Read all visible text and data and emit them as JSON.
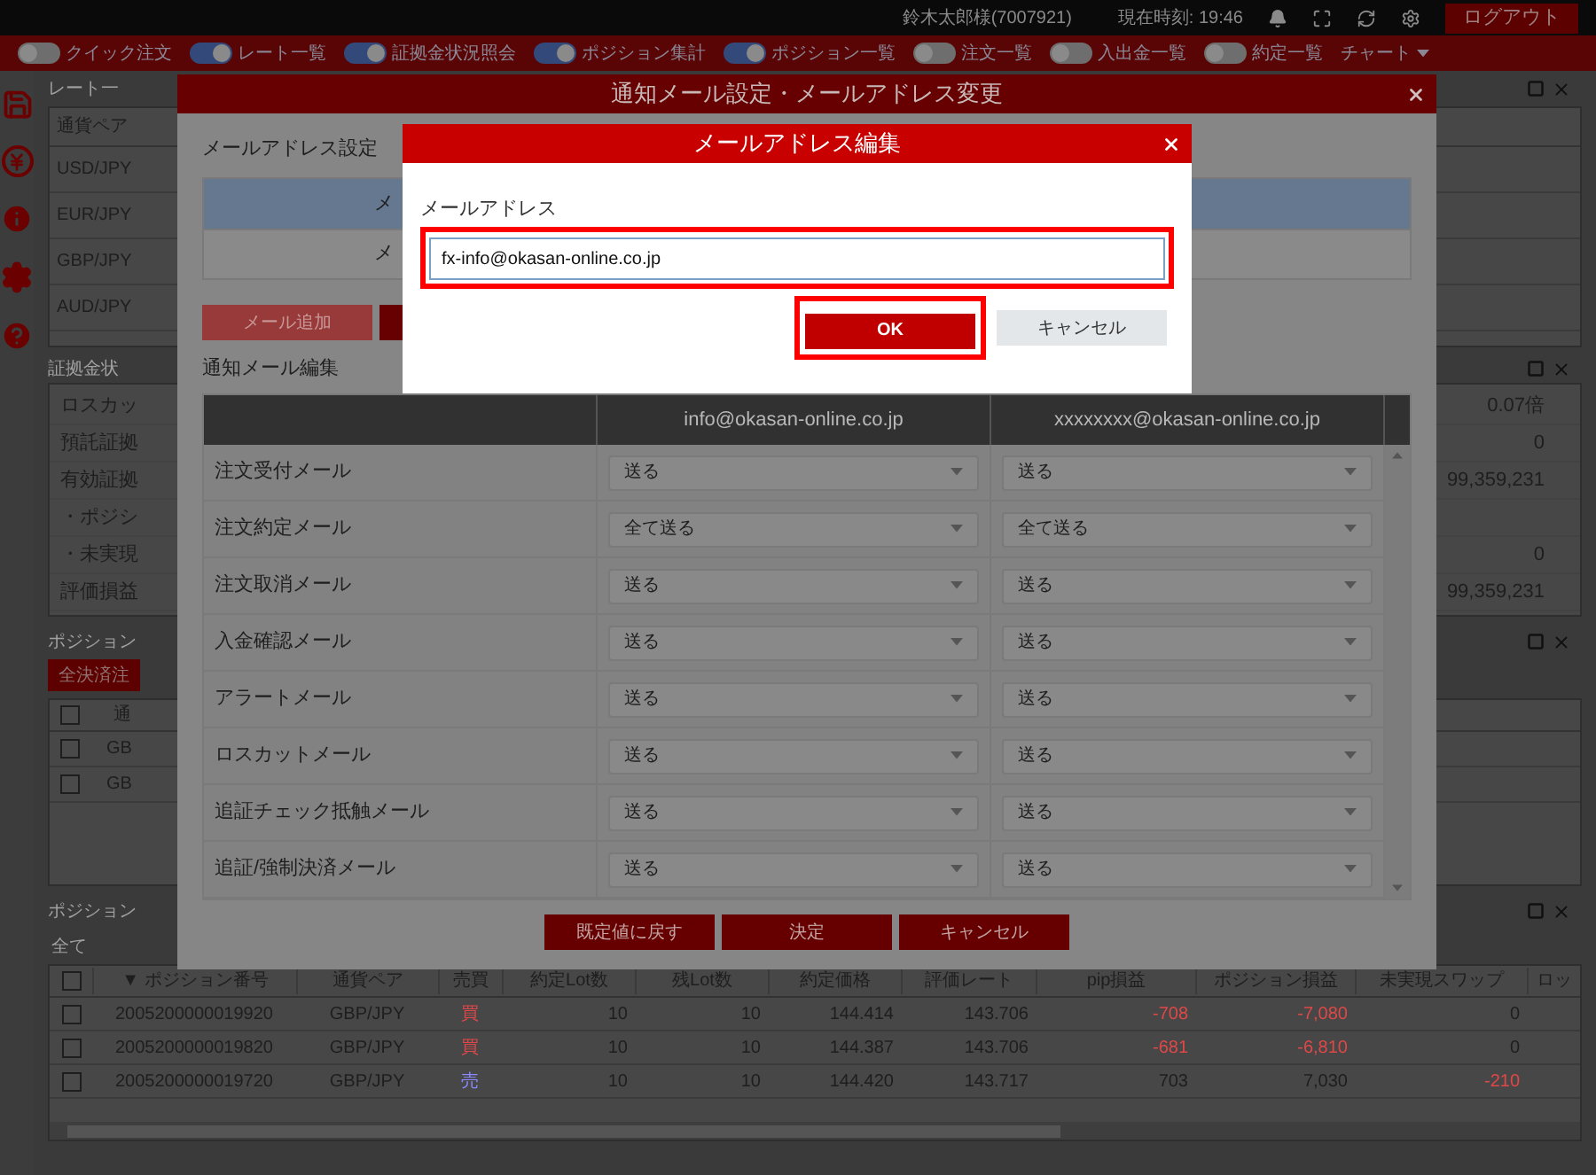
{
  "top_bar": {
    "user": "鈴木太郎様(7007921)",
    "clock": "現在時刻: 19:46",
    "logout": "ログアウト"
  },
  "nav": {
    "toggles": [
      {
        "label": "クイック注文",
        "on": false
      },
      {
        "label": "レート一覧",
        "on": true
      },
      {
        "label": "証拠金状況照会",
        "on": true
      },
      {
        "label": "ポジション集計",
        "on": true
      },
      {
        "label": "ポジション一覧",
        "on": true
      },
      {
        "label": "注文一覧",
        "on": false
      },
      {
        "label": "入出金一覧",
        "on": false
      },
      {
        "label": "約定一覧",
        "on": false
      }
    ],
    "chart_menu": "チャート"
  },
  "rate_panel": {
    "title": "レート一",
    "column": "通貨ペア",
    "pairs": [
      "USD/JPY",
      "EUR/JPY",
      "GBP/JPY",
      "AUD/JPY"
    ]
  },
  "margin_panel": {
    "title": "証拠金状",
    "rows": [
      {
        "label": "ロスカッ",
        "value": "0.07倍"
      },
      {
        "label": "預託証拠",
        "value": "0"
      },
      {
        "label": "有効証拠",
        "value": "99,359,231"
      },
      {
        "label": "・ポジシ"
      },
      {
        "label": "・未実現",
        "value": "0"
      },
      {
        "label": "評価損益",
        "value": "99,359,231"
      }
    ]
  },
  "summary_panel": {
    "title": "ポジション",
    "close_all": "全決済注",
    "header": "通",
    "all_checked": false,
    "rows": [
      {
        "pair": "GB",
        "checked": false
      },
      {
        "pair": "GB",
        "checked": false
      }
    ]
  },
  "positions_panel": {
    "title": "ポジション",
    "filter": "全て",
    "all_checked": false,
    "columns": [
      "▼ ポジション番号",
      "通貨ペア",
      "売買",
      "約定Lot数",
      "残Lot数",
      "約定価格",
      "評価レート",
      "pip損益",
      "ポジション損益",
      "未実現スワップ",
      "ロッ"
    ],
    "rows": [
      {
        "checked": false,
        "cells": [
          {
            "text": "2005200000019920"
          },
          {
            "text": "GBP/JPY"
          },
          {
            "text": "買",
            "color": "#e04848"
          },
          {
            "text": "10"
          },
          {
            "text": "10"
          },
          {
            "text": "144.414"
          },
          {
            "text": "143.706"
          },
          {
            "text": "-708",
            "color": "#e04848"
          },
          {
            "text": "-7,080",
            "color": "#e04848"
          },
          {
            "text": "0"
          }
        ]
      },
      {
        "checked": false,
        "cells": [
          {
            "text": "2005200000019820"
          },
          {
            "text": "GBP/JPY"
          },
          {
            "text": "買",
            "color": "#e04848"
          },
          {
            "text": "10"
          },
          {
            "text": "10"
          },
          {
            "text": "144.387"
          },
          {
            "text": "143.706"
          },
          {
            "text": "-681",
            "color": "#e04848"
          },
          {
            "text": "-6,810",
            "color": "#e04848"
          },
          {
            "text": "0"
          }
        ]
      },
      {
        "checked": false,
        "cells": [
          {
            "text": "2005200000019720"
          },
          {
            "text": "GBP/JPY"
          },
          {
            "text": "売",
            "color": "#8a8aff"
          },
          {
            "text": "10"
          },
          {
            "text": "10"
          },
          {
            "text": "144.420"
          },
          {
            "text": "143.717"
          },
          {
            "text": "703"
          },
          {
            "text": "7,030"
          },
          {
            "text": "-210",
            "color": "#e04848"
          }
        ]
      }
    ]
  },
  "settings_dialog": {
    "title": "通知メール設定・メールアドレス変更",
    "address_section": "メールアドレス設定",
    "address_rows": [
      {
        "text": "メ",
        "selected": true
      },
      {
        "text": "メ",
        "selected": false
      }
    ],
    "add_button": "メール追加",
    "notify_section": "通知メール編集",
    "columns": [
      "info@okasan-online.co.jp",
      "xxxxxxxx@okasan-online.co.jp"
    ],
    "rows": [
      {
        "label": "注文受付メール",
        "values": [
          "送る",
          "送る"
        ]
      },
      {
        "label": "注文約定メール",
        "values": [
          "全て送る",
          "全て送る"
        ]
      },
      {
        "label": "注文取消メール",
        "values": [
          "送る",
          "送る"
        ]
      },
      {
        "label": "入金確認メール",
        "values": [
          "送る",
          "送る"
        ]
      },
      {
        "label": "アラートメール",
        "values": [
          "送る",
          "送る"
        ]
      },
      {
        "label": "ロスカットメール",
        "values": [
          "送る",
          "送る"
        ]
      },
      {
        "label": "追証チェック抵触メール",
        "values": [
          "送る",
          "送る"
        ]
      },
      {
        "label": "追証/強制決済メール",
        "values": [
          "送る",
          "送る"
        ]
      }
    ],
    "buttons": [
      "既定値に戻す",
      "決定",
      "キャンセル"
    ]
  },
  "edit_dialog": {
    "title": "メールアドレス編集",
    "field_label": "メールアドレス",
    "value": "fx-info@okasan-online.co.jp",
    "field_highlighted": true,
    "ok": "OK",
    "ok_highlighted": true,
    "cancel": "キャンセル"
  }
}
